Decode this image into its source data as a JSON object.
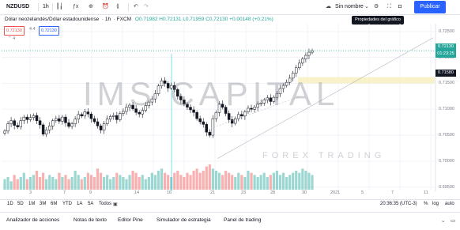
{
  "toolbar": {
    "symbol": "NZDUSD",
    "interval": "1h",
    "layout_name": "Sin nombre",
    "publish_label": "Publicar",
    "tooltip": "Propiedades del gráfico"
  },
  "legend": {
    "title": "Dólar neozelandés/Dólar estadounidense",
    "interval": "1h",
    "exchange": "FXCM",
    "ohlc": "O0.71982 H0.72131 L0.71959 C0.72130 +0.00148 (+0.21%)",
    "bid": "0.72130",
    "spread": "4.4",
    "ask": "0.72130",
    "volume_marker": "4"
  },
  "price_axis": {
    "ticks": [
      "0.72500",
      "0.72000",
      "0.71500",
      "0.71000",
      "0.70500",
      "0.70000",
      "0.69500"
    ],
    "current_price": "0.72130",
    "countdown": "01:23:25",
    "level_price": "0.71580"
  },
  "time_axis": {
    "labels": [
      "3",
      "7",
      "9",
      "14",
      "16",
      "21",
      "23",
      "28",
      "30",
      "2021",
      "5",
      "7",
      "11"
    ]
  },
  "range_bar": {
    "ranges": [
      "1D",
      "5D",
      "1M",
      "3M",
      "6M",
      "YTD",
      "1A",
      "5A",
      "Todos"
    ],
    "time": "20:36:35 (UTC-3)",
    "percent": "%",
    "log": "log",
    "auto": "auto"
  },
  "bottom_tabs": [
    "Analizador de acciones",
    "Notas de texto",
    "Editor Pine",
    "Simulador de estrategia",
    "Panel de trading"
  ],
  "watermark": {
    "main": "IMS CAPITAL",
    "sub": "FOREX TRADING"
  },
  "colors": {
    "up": "#26a69a",
    "down": "#ef5350",
    "accent": "#2962ff",
    "zone": "#f7eebf"
  },
  "chart_data": {
    "type": "candlestick",
    "symbol": "NZDUSD",
    "ylim": [
      0.6945,
      0.7265
    ],
    "close": [
      0.7058,
      0.7072,
      0.7078,
      0.7069,
      0.7066,
      0.7078,
      0.7085,
      0.708,
      0.7084,
      0.7088,
      0.7078,
      0.707,
      0.7052,
      0.706,
      0.7068,
      0.7078,
      0.7082,
      0.7077,
      0.7085,
      0.7074,
      0.7067,
      0.7072,
      0.7081,
      0.709,
      0.7087,
      0.7095,
      0.7091,
      0.7082,
      0.7076,
      0.7068,
      0.706,
      0.7072,
      0.7081,
      0.7086,
      0.7088,
      0.708,
      0.7092,
      0.7096,
      0.7104,
      0.7108,
      0.7101,
      0.7094,
      0.7091,
      0.7098,
      0.7107,
      0.7114,
      0.712,
      0.713,
      0.7145,
      0.7155,
      0.715,
      0.7141,
      0.7146,
      0.7138,
      0.7125,
      0.7118,
      0.711,
      0.7104,
      0.7099,
      0.7094,
      0.7082,
      0.7076,
      0.7071,
      0.7056,
      0.705,
      0.7082,
      0.7094,
      0.711,
      0.7104,
      0.7092,
      0.708,
      0.7073,
      0.7082,
      0.709,
      0.7087,
      0.7095,
      0.7102,
      0.71,
      0.7104,
      0.711,
      0.7112,
      0.7118,
      0.7122,
      0.7115,
      0.7123,
      0.713,
      0.714,
      0.7146,
      0.7152,
      0.716,
      0.717,
      0.718,
      0.7189,
      0.7197,
      0.7204,
      0.721,
      0.7213
    ],
    "volume": [
      5,
      6,
      4,
      7,
      5,
      6,
      8,
      5,
      6,
      7,
      9,
      6,
      8,
      5,
      7,
      6,
      5,
      8,
      6,
      7,
      5,
      6,
      9,
      7,
      5,
      6,
      8,
      7,
      6,
      10,
      8,
      6,
      7,
      5,
      6,
      8,
      7,
      6,
      5,
      7,
      9,
      8,
      6,
      7,
      5,
      6,
      8,
      7,
      9,
      10,
      8,
      7,
      6,
      8,
      9,
      7,
      6,
      8,
      7,
      9,
      10,
      8,
      9,
      11,
      12,
      10,
      9,
      8,
      7,
      9,
      8,
      7,
      6,
      8,
      7,
      6,
      9,
      8,
      7,
      6,
      7,
      8,
      6,
      7,
      8,
      9,
      7,
      8,
      6,
      7,
      8,
      9,
      8,
      10,
      9,
      8,
      7
    ],
    "current_price": 0.7213,
    "level": 0.7158,
    "zone": [
      0.715,
      0.7162
    ]
  }
}
